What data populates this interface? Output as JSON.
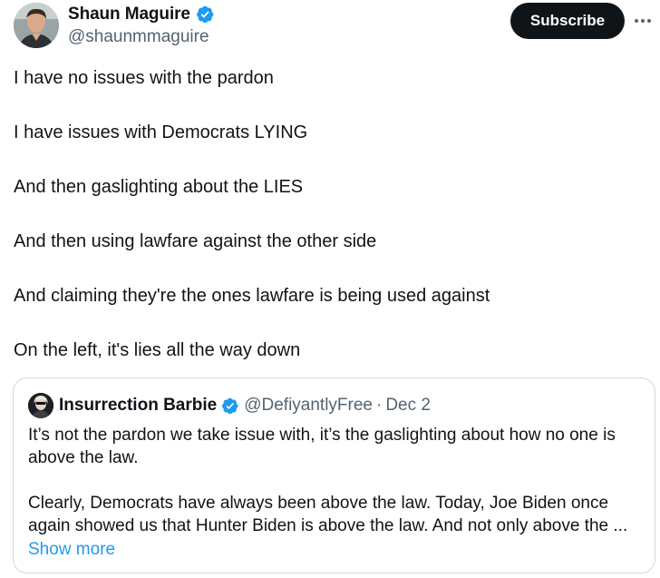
{
  "author": {
    "name": "Shaun Maguire",
    "handle": "@shaunmmaguire",
    "verified": true,
    "avatar_icon": "avatar-photo"
  },
  "actions": {
    "subscribe_label": "Subscribe",
    "more_icon": "more-horizontal-icon"
  },
  "tweet": {
    "lines": [
      "I have no issues with the pardon",
      "I have issues with Democrats LYING",
      "And then gaslighting about the LIES",
      "And then using lawfare against the other side",
      "And claiming they're the ones lawfare is being used against",
      "On the left, it's lies all the way down"
    ]
  },
  "quote": {
    "name": "Insurrection Barbie",
    "handle": "@DefiyantlyFree",
    "separator": "·",
    "date": "Dec 2",
    "verified": true,
    "paragraphs": [
      "It’s not the pardon we take issue with, it’s the gaslighting about how no one is above the law.",
      "Clearly, Democrats have always been above the law. Today, Joe Biden once again showed us that Hunter Biden is above the law. And not only above the ..."
    ],
    "show_more_label": "Show more"
  },
  "colors": {
    "verified_blue": "#1d9bf0",
    "text_primary": "#0f1419",
    "text_secondary": "#536471",
    "link": "#1d9bf0",
    "border": "#cfd9de",
    "button_bg": "#0f1419"
  }
}
